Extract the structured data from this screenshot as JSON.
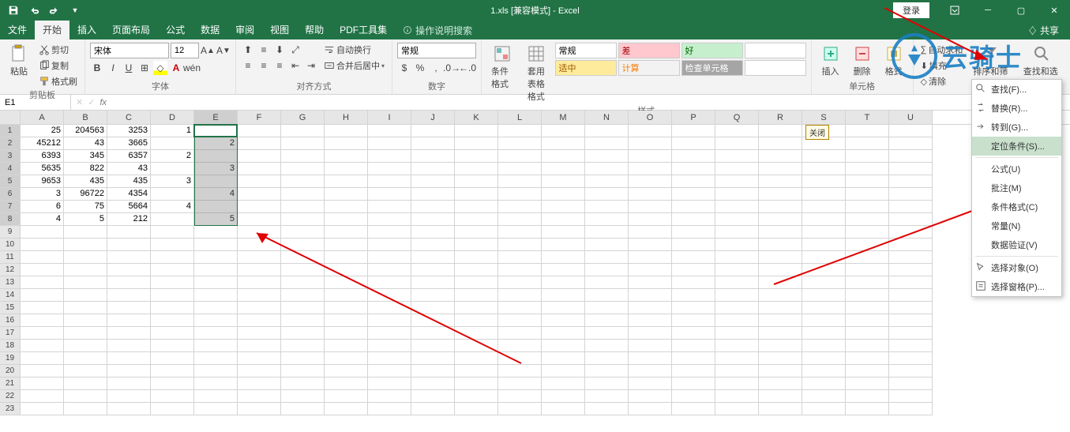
{
  "title": "1.xls [兼容模式] - Excel",
  "login": "登录",
  "menus": {
    "file": "文件",
    "home": "开始",
    "insert": "插入",
    "layout": "页面布局",
    "formulas": "公式",
    "data": "数据",
    "review": "审阅",
    "view": "视图",
    "help": "帮助",
    "pdf": "PDF工具集",
    "tellme": "操作说明搜索",
    "share": "共享"
  },
  "ribbon": {
    "clipboard": {
      "label": "剪贴板",
      "paste": "粘贴",
      "cut": "剪切",
      "copy": "复制",
      "painter": "格式刷"
    },
    "font": {
      "label": "字体",
      "name": "宋体",
      "size": "12"
    },
    "align": {
      "label": "对齐方式",
      "wrap": "自动换行",
      "merge": "合并后居中"
    },
    "number": {
      "label": "数字",
      "format": "常规"
    },
    "styles": {
      "label": "样式",
      "cond": "条件格式",
      "table": "套用\n表格格式",
      "gallery": [
        {
          "t": "常规",
          "bg": "#ffffff",
          "fg": "#000"
        },
        {
          "t": "差",
          "bg": "#ffc7ce",
          "fg": "#9c0006"
        },
        {
          "t": "好",
          "bg": "#c6efce",
          "fg": "#006100"
        },
        {
          "t": "",
          "bg": "#fff",
          "fg": "#000"
        },
        {
          "t": "适中",
          "bg": "#ffeb9c",
          "fg": "#9c5700"
        },
        {
          "t": "计算",
          "bg": "#f2f2f2",
          "fg": "#fa7d00"
        },
        {
          "t": "检查单元格",
          "bg": "#a5a5a5",
          "fg": "#fff"
        },
        {
          "t": "",
          "bg": "#fff",
          "fg": "#000"
        }
      ]
    },
    "cells": {
      "label": "单元格",
      "insert": "插入",
      "delete": "删除",
      "format": "格式"
    },
    "editing": {
      "label": "编辑",
      "sum": "自动求和",
      "fill": "填充",
      "clear": "清除",
      "sort": "排序和筛选",
      "find": "查找和选择"
    }
  },
  "namebox": "E1",
  "fx": "fx",
  "columns": [
    "A",
    "B",
    "C",
    "D",
    "E",
    "F",
    "G",
    "H",
    "I",
    "J",
    "K",
    "L",
    "M",
    "N",
    "O",
    "P",
    "Q",
    "R",
    "S",
    "T",
    "U"
  ],
  "selected_col": "E",
  "close_tag": "关闭",
  "rows": [
    {
      "n": 1,
      "A": "25",
      "B": "204563",
      "C": "3253",
      "D": "1",
      "E": ""
    },
    {
      "n": 2,
      "A": "45212",
      "B": "43",
      "C": "3665",
      "D": "",
      "E": "2"
    },
    {
      "n": 3,
      "A": "6393",
      "B": "345",
      "C": "6357",
      "D": "2",
      "E": ""
    },
    {
      "n": 4,
      "A": "5635",
      "B": "822",
      "C": "43",
      "D": "",
      "E": "3"
    },
    {
      "n": 5,
      "A": "9653",
      "B": "435",
      "C": "435",
      "D": "3",
      "E": ""
    },
    {
      "n": 6,
      "A": "3",
      "B": "96722",
      "C": "4354",
      "D": "",
      "E": "4"
    },
    {
      "n": 7,
      "A": "6",
      "B": "75",
      "C": "5664",
      "D": "4",
      "E": ""
    },
    {
      "n": 8,
      "A": "4",
      "B": "5",
      "C": "212",
      "D": "",
      "E": "5"
    }
  ],
  "blank_rows": 15,
  "context_menu": {
    "find": "查找(F)...",
    "replace": "替换(R)...",
    "goto": "转到(G)...",
    "special": "定位条件(S)...",
    "formulas": "公式(U)",
    "notes": "批注(M)",
    "condfmt": "条件格式(C)",
    "constants": "常量(N)",
    "validation": "数据验证(V)",
    "selobj": "选择对象(O)",
    "selpane": "选择窗格(P)..."
  },
  "watermark": "云骑士"
}
